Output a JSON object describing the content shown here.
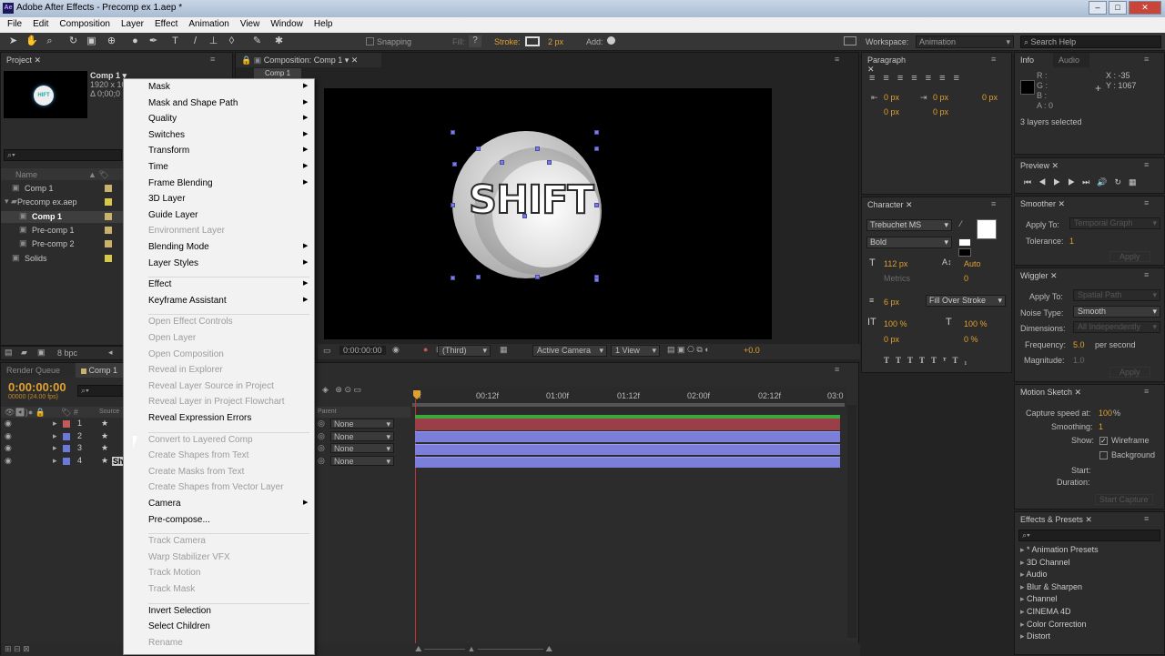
{
  "window": {
    "title": "Adobe After Effects - Precomp ex 1.aep *",
    "app_icon": "Ae",
    "controls": [
      "minimize-icon",
      "maximize-icon",
      "close-icon"
    ]
  },
  "menubar": [
    "File",
    "Edit",
    "Composition",
    "Layer",
    "Effect",
    "Animation",
    "View",
    "Window",
    "Help"
  ],
  "toolbar": {
    "snapping": "Snapping",
    "fill": "Fill:",
    "stroke": "Stroke:",
    "stroke_px": "2 px",
    "add": "Add:",
    "workspace_label": "Workspace:",
    "workspace_value": "Animation",
    "search_placeholder": "Search Help"
  },
  "project": {
    "tab": "Project",
    "comp_name": "Comp 1 ▾",
    "comp_info1": "1920 x 10",
    "comp_info2": "Δ 0;00;0",
    "thumb_text": "HIFT",
    "bpc": "8 bpc",
    "col_name": "Name",
    "items": [
      {
        "label": "Comp 1",
        "color": "#c9b26a",
        "indent": 1
      },
      {
        "label": "Precomp ex.aep",
        "color": "#d6c94a",
        "indent": 0
      },
      {
        "label": "Comp 1",
        "color": "#c9b26a",
        "indent": 2,
        "selected": true
      },
      {
        "label": "Pre-comp 1",
        "color": "#c9b26a",
        "indent": 2
      },
      {
        "label": "Pre-comp 2",
        "color": "#c9b26a",
        "indent": 2
      },
      {
        "label": "Solids",
        "color": "#d6c94a",
        "indent": 1
      }
    ]
  },
  "composition": {
    "tab": "Composition: Comp 1",
    "subtab": "Comp 1",
    "text": "SHIFT",
    "timecode": "0:00:00:00",
    "view": "(Third)",
    "camera": "Active Camera",
    "views": "1 View",
    "offset": "+0.0"
  },
  "timeline": {
    "tabs": [
      "Render Queue",
      "Comp 1"
    ],
    "timecode": "0:00:00:00",
    "frames": "00000 (24.00 fps)",
    "col_source": "Source",
    "col_parent": "Parent",
    "ruler": [
      "0f",
      "00:12f",
      "01:00f",
      "01:12f",
      "02:00f",
      "02:12f",
      "03:0"
    ],
    "layers": [
      {
        "num": "1",
        "color": "#c25a5a",
        "parent": "None"
      },
      {
        "num": "2",
        "color": "#6a7ad8",
        "parent": "None"
      },
      {
        "num": "3",
        "color": "#6a7ad8",
        "parent": "None"
      },
      {
        "num": "4",
        "color": "#6a7ad8",
        "parent": "None"
      }
    ],
    "layer4_label": "Sh"
  },
  "context_menu": [
    {
      "label": "Mask",
      "sub": true
    },
    {
      "label": "Mask and Shape Path",
      "sub": true
    },
    {
      "label": "Quality",
      "sub": true
    },
    {
      "label": "Switches",
      "sub": true
    },
    {
      "label": "Transform",
      "sub": true
    },
    {
      "label": "Time",
      "sub": true
    },
    {
      "label": "Frame Blending",
      "sub": true
    },
    {
      "label": "3D Layer"
    },
    {
      "label": "Guide Layer"
    },
    {
      "label": "Environment Layer",
      "disabled": true
    },
    {
      "label": "Blending Mode",
      "sub": true
    },
    {
      "label": "Layer Styles",
      "sub": true
    },
    {
      "sep": true
    },
    {
      "label": "Effect",
      "sub": true
    },
    {
      "label": "Keyframe Assistant",
      "sub": true
    },
    {
      "sep": true
    },
    {
      "label": "Open Effect Controls",
      "disabled": true
    },
    {
      "label": "Open Layer",
      "disabled": true
    },
    {
      "label": "Open Composition",
      "disabled": true
    },
    {
      "label": "Reveal in Explorer",
      "disabled": true
    },
    {
      "label": "Reveal Layer Source in Project",
      "disabled": true
    },
    {
      "label": "Reveal Layer in Project Flowchart",
      "disabled": true
    },
    {
      "label": "Reveal Expression Errors"
    },
    {
      "sep": true
    },
    {
      "label": "Convert to Layered Comp",
      "disabled": true
    },
    {
      "label": "Create Shapes from Text",
      "disabled": true
    },
    {
      "label": "Create Masks from Text",
      "disabled": true
    },
    {
      "label": "Create Shapes from Vector Layer",
      "disabled": true
    },
    {
      "label": "Camera",
      "sub": true
    },
    {
      "label": "Pre-compose..."
    },
    {
      "sep": true
    },
    {
      "label": "Track Camera",
      "disabled": true
    },
    {
      "label": "Warp Stabilizer VFX",
      "disabled": true
    },
    {
      "label": "Track Motion",
      "disabled": true
    },
    {
      "label": "Track Mask",
      "disabled": true
    },
    {
      "sep": true
    },
    {
      "label": "Invert Selection"
    },
    {
      "label": "Select Children"
    },
    {
      "label": "Rename",
      "disabled": true
    }
  ],
  "paragraph": {
    "tab": "Paragraph",
    "vals": [
      "0 px",
      "0 px",
      "0 px",
      "0 px",
      "0 px"
    ]
  },
  "character": {
    "tab": "Character",
    "font": "Trebuchet MS",
    "style": "Bold",
    "size": "112 px",
    "leading": "Auto",
    "kerning": "Metrics",
    "tracking": "0",
    "stroke_w": "6 px",
    "stroke_mode": "Fill Over Stroke",
    "vscale": "100 %",
    "hscale": "100 %",
    "baseline": "0 px",
    "tsume": "0 %"
  },
  "info": {
    "tabs": [
      "Info",
      "Audio"
    ],
    "r": "R :",
    "g": "G :",
    "b": "B :",
    "a": "A : 0",
    "x": "X : -35",
    "y": "Y : 1067",
    "status": "3 layers selected"
  },
  "preview": {
    "tab": "Preview"
  },
  "smoother": {
    "tab": "Smoother",
    "apply_to": "Apply To:",
    "apply_val": "Temporal Graph",
    "tolerance": "Tolerance:",
    "tol_val": "1",
    "apply_btn": "Apply"
  },
  "wiggler": {
    "tab": "Wiggler",
    "apply_to": "Apply To:",
    "apply_val": "Spatial Path",
    "noise": "Noise Type:",
    "noise_val": "Smooth",
    "dims": "Dimensions:",
    "dims_val": "All Independently",
    "freq": "Frequency:",
    "freq_val": "5.0",
    "freq_unit": "per second",
    "mag": "Magnitude:",
    "mag_val": "1.0",
    "apply_btn": "Apply"
  },
  "motion_sketch": {
    "tab": "Motion Sketch",
    "capture": "Capture speed at:",
    "capture_val": "100",
    "capture_unit": "%",
    "smoothing": "Smoothing:",
    "smooth_val": "1",
    "show": "Show:",
    "wireframe": "Wireframe",
    "background": "Background",
    "start": "Start:",
    "duration": "Duration:",
    "btn": "Start Capture"
  },
  "effects": {
    "tab": "Effects & Presets",
    "items": [
      "* Animation Presets",
      "3D Channel",
      "Audio",
      "Blur & Sharpen",
      "Channel",
      "CINEMA 4D",
      "Color Correction",
      "Distort"
    ]
  }
}
